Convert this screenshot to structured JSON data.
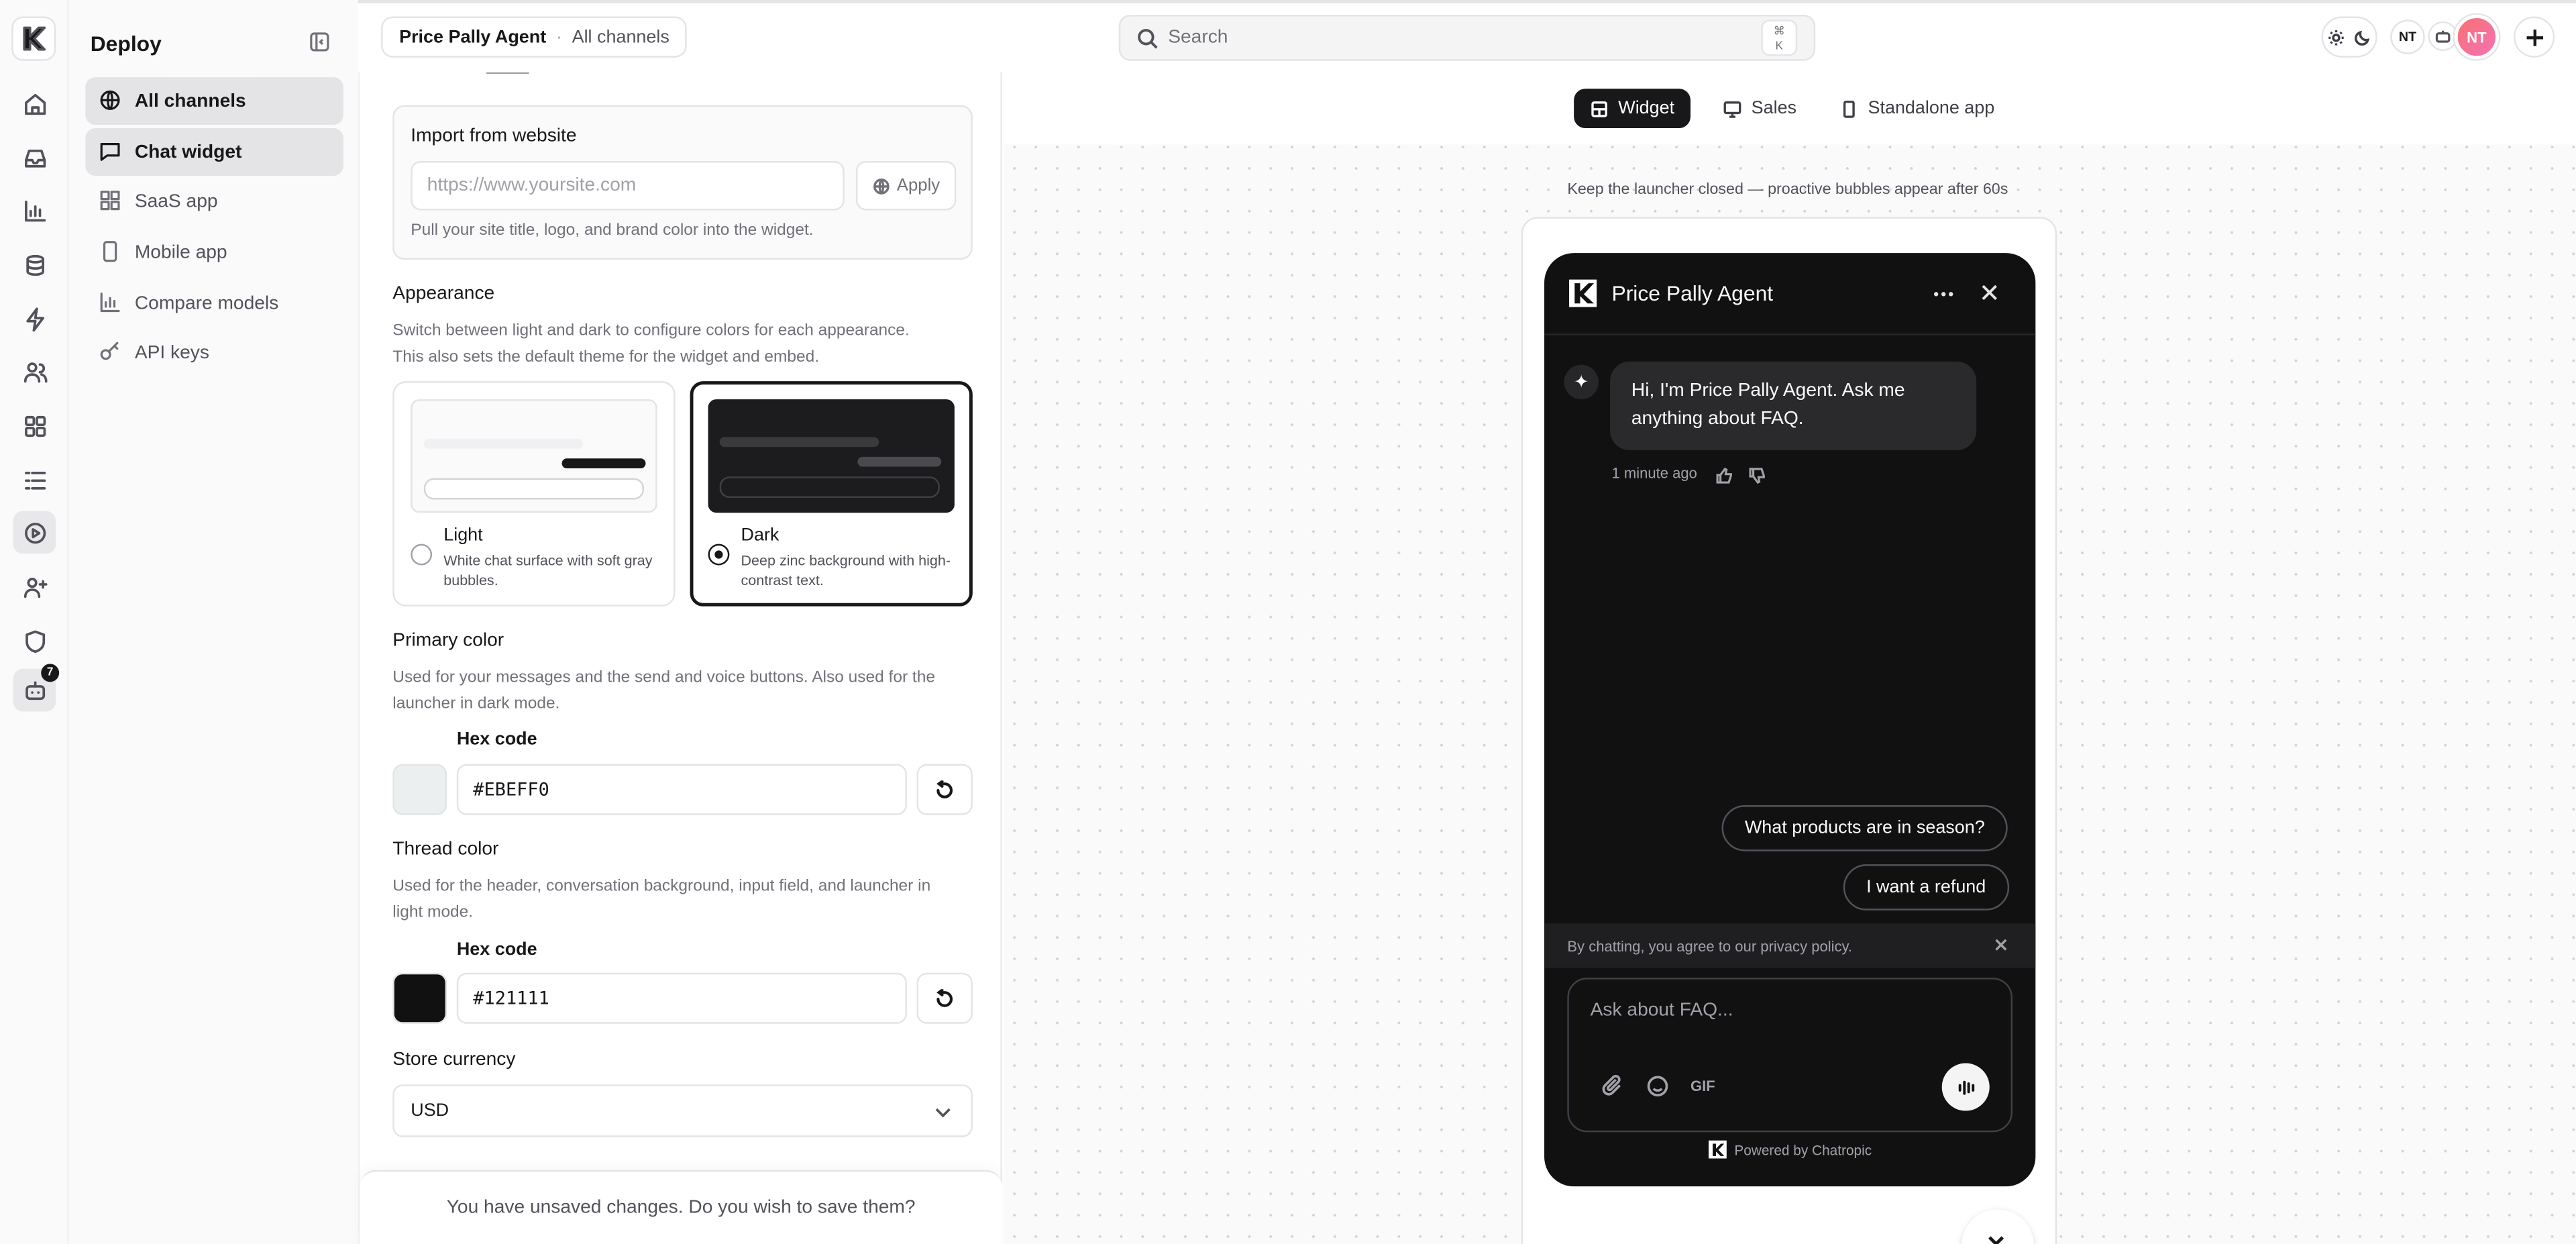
{
  "sidebar": {
    "title": "Deploy",
    "items": [
      {
        "label": "All channels",
        "icon": "globe-icon"
      },
      {
        "label": "Chat widget",
        "icon": "chat-icon"
      },
      {
        "label": "SaaS app",
        "icon": "grid-icon"
      },
      {
        "label": "Mobile app",
        "icon": "phone-icon"
      },
      {
        "label": "Compare models",
        "icon": "bar-chart-icon"
      },
      {
        "label": "API keys",
        "icon": "key-icon"
      }
    ],
    "rail_badge": "7"
  },
  "header": {
    "breadcrumb_agent": "Price Pally Agent",
    "breadcrumb_separator": "·",
    "breadcrumb_section": "All channels",
    "search_placeholder": "Search",
    "search_shortcut_1": "⌘",
    "search_shortcut_2": "K",
    "user_initials_small": "NT",
    "user_initials": "NT"
  },
  "config": {
    "import": {
      "label": "Import from website",
      "placeholder": "https://www.yoursite.com",
      "apply_label": "Apply",
      "help": "Pull your site title, logo, and brand color into the widget."
    },
    "appearance": {
      "label": "Appearance",
      "description_line1": "Switch between light and dark to configure colors for each appearance.",
      "description_line2": "This also sets the default theme for the widget and embed.",
      "light_name": "Light",
      "light_desc": "White chat surface with soft gray bubbles.",
      "dark_name": "Dark",
      "dark_desc": "Deep zinc background with high-contrast text.",
      "selected": "Dark"
    },
    "primary": {
      "label": "Primary color",
      "description_line1": "Used for your messages and the send and voice buttons. Also used for the",
      "description_line2": "launcher in dark mode.",
      "hex_label": "Hex code",
      "hex_value": "#EBEFF0",
      "swatch_color": "#EBEFF0"
    },
    "thread": {
      "label": "Thread color",
      "description_line1": "Used for the header, conversation background, input field, and launcher in",
      "description_line2": "light mode.",
      "hex_label": "Hex code",
      "hex_value": "#121111",
      "swatch_color": "#121111"
    },
    "currency": {
      "label": "Store currency",
      "value": "USD"
    },
    "unsaved_message": "You have unsaved changes. Do you wish to save them?"
  },
  "preview": {
    "tabs": [
      {
        "label": "Widget",
        "icon": "layout-icon"
      },
      {
        "label": "Sales",
        "icon": "monitor-icon"
      },
      {
        "label": "Standalone app",
        "icon": "phone-icon"
      }
    ],
    "hint": "Keep the launcher closed — proactive bubbles appear after 60s",
    "widget": {
      "title": "Price Pally Agent",
      "message": "Hi, I'm Price Pally Agent. Ask me anything about FAQ.",
      "timestamp": "1 minute ago",
      "suggestions": [
        "What products are in season?",
        "I want a refund"
      ],
      "privacy": "By chatting, you agree to our privacy policy.",
      "input_placeholder": "Ask about FAQ...",
      "gif_label": "GIF",
      "powered_by": "Powered by Chatropic"
    }
  }
}
